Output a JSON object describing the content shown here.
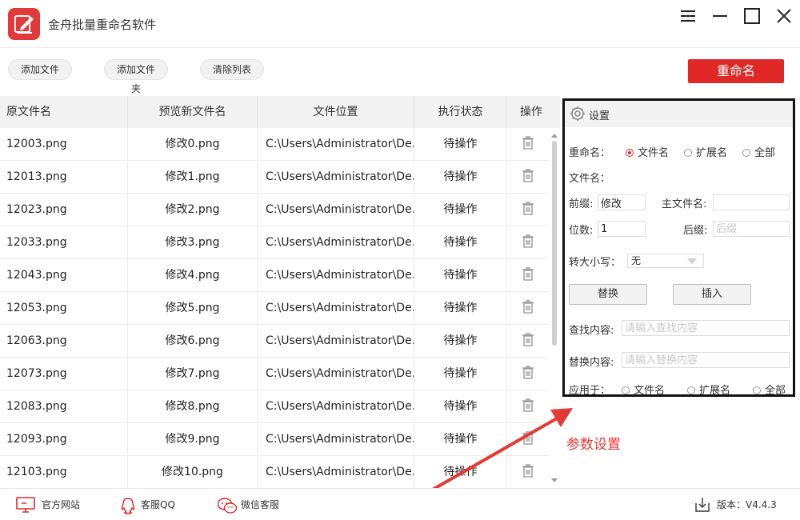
{
  "app": {
    "title": "金舟批量重命名软件",
    "icons": {
      "logo": "app-logo-icon",
      "menu": "menu-icon",
      "minimize": "minimize-icon",
      "maximize": "maximize-icon",
      "close": "close-icon"
    }
  },
  "toolbar": {
    "add_file": "添加文件",
    "add_folder": "添加文件夹",
    "clear_list": "清除列表",
    "rename": "重命名"
  },
  "table": {
    "headers": [
      "原文件名",
      "预览新文件名",
      "文件位置",
      "执行状态",
      "操作"
    ],
    "rows": [
      {
        "orig": "12003.png",
        "preview": "修改0.png",
        "location": "C:\\Users\\Administrator\\De...",
        "status": "待操作"
      },
      {
        "orig": "12013.png",
        "preview": "修改1.png",
        "location": "C:\\Users\\Administrator\\De...",
        "status": "待操作"
      },
      {
        "orig": "12023.png",
        "preview": "修改2.png",
        "location": "C:\\Users\\Administrator\\De...",
        "status": "待操作"
      },
      {
        "orig": "12033.png",
        "preview": "修改3.png",
        "location": "C:\\Users\\Administrator\\De...",
        "status": "待操作"
      },
      {
        "orig": "12043.png",
        "preview": "修改4.png",
        "location": "C:\\Users\\Administrator\\De...",
        "status": "待操作"
      },
      {
        "orig": "12053.png",
        "preview": "修改5.png",
        "location": "C:\\Users\\Administrator\\De...",
        "status": "待操作"
      },
      {
        "orig": "12063.png",
        "preview": "修改6.png",
        "location": "C:\\Users\\Administrator\\De...",
        "status": "待操作"
      },
      {
        "orig": "12073.png",
        "preview": "修改7.png",
        "location": "C:\\Users\\Administrator\\De...",
        "status": "待操作"
      },
      {
        "orig": "12083.png",
        "preview": "修改8.png",
        "location": "C:\\Users\\Administrator\\De...",
        "status": "待操作"
      },
      {
        "orig": "12093.png",
        "preview": "修改9.png",
        "location": "C:\\Users\\Administrator\\De...",
        "status": "待操作"
      },
      {
        "orig": "12103.png",
        "preview": "修改10.png",
        "location": "C:\\Users\\Administrator\\De...",
        "status": "待操作"
      }
    ],
    "action_icon": "trash-icon"
  },
  "settings": {
    "title": "设置",
    "rename_label": "重命名：",
    "rename_options": [
      {
        "label": "文件名",
        "selected": true
      },
      {
        "label": "扩展名",
        "selected": false
      },
      {
        "label": "全部",
        "selected": false
      }
    ],
    "filename_label": "文件名：",
    "prefix_label": "前缀:",
    "prefix_value": "修改",
    "main_name_label": "主文件名:",
    "main_name_value": "",
    "digits_label": "位数:",
    "digits_value": "1",
    "suffix_label": "后缀:",
    "suffix_placeholder": "后缀",
    "case_label": "转大小写：",
    "case_value": "无",
    "replace_button": "替换",
    "insert_button": "插入",
    "find_label": "查找内容:",
    "find_placeholder": "请输入查找内容",
    "replace_label": "替换内容:",
    "replace_placeholder": "请输入替换内容",
    "apply_label": "应用于：",
    "apply_options": [
      {
        "label": "文件名",
        "selected": false
      },
      {
        "label": "扩展名",
        "selected": false
      },
      {
        "label": "全部",
        "selected": false
      }
    ]
  },
  "annotation": {
    "text": "参数设置",
    "color": "#e53935"
  },
  "statusbar": {
    "website": "官方网站",
    "qq": "客服QQ",
    "wechat": "微信客服",
    "version": "版本：V4.4.3"
  },
  "colors": {
    "accent": "#e02826",
    "header_bg": "#f2f2f2"
  }
}
